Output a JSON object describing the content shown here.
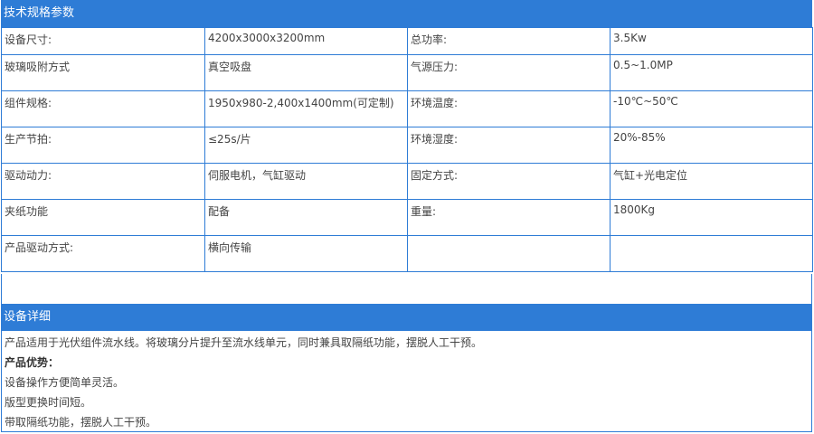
{
  "specs": {
    "title": "技术规格参数",
    "rows": [
      {
        "label1": "设备尺寸:",
        "value1": "4200x3000x3200mm",
        "label2": "总功率:",
        "value2": "3.5Kw"
      },
      {
        "label1": "玻璃吸附方式",
        "value1": "真空吸盘",
        "label2": "气源压力:",
        "value2": "0.5~1.0MP"
      },
      {
        "label1": "组件规格:",
        "value1": "1950x980-2,400x1400mm(可定制)",
        "label2": "环境温度:",
        "value2": "-10℃~50℃"
      },
      {
        "label1": "生产节拍:",
        "value1": "≤25s/片",
        "label2": "环境湿度:",
        "value2": "20%-85%"
      },
      {
        "label1": "驱动动力:",
        "value1": "伺服电机，气缸驱动",
        "label2": "固定方式:",
        "value2": "气缸+光电定位"
      },
      {
        "label1": "夹纸功能",
        "value1": "配备",
        "label2": "重量:",
        "value2": "1800Kg"
      },
      {
        "label1": "产品驱动方式:",
        "value1": "横向传输",
        "label2": "",
        "value2": ""
      }
    ]
  },
  "detail": {
    "title": "设备详细",
    "intro": "产品适用于光伏组件流水线。将玻璃分片提升至流水线单元，同时兼具取隔纸功能，摆脱人工干预。",
    "advantages_heading": "产品优势：",
    "advantages": [
      "设备操作方便简单灵活。",
      "版型更换时间短。",
      "带取隔纸功能，摆脱人工干预。"
    ]
  }
}
